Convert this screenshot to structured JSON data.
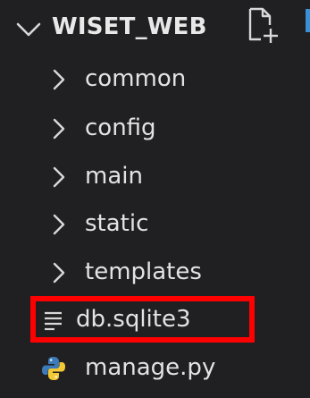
{
  "explorer": {
    "project_title": "WISET_WEB",
    "new_file_icon": "new-file-icon",
    "folders": [
      {
        "label": "common",
        "icon": "chevron-right-icon"
      },
      {
        "label": "config",
        "icon": "chevron-right-icon"
      },
      {
        "label": "main",
        "icon": "chevron-right-icon"
      },
      {
        "label": "static",
        "icon": "chevron-right-icon"
      },
      {
        "label": "templates",
        "icon": "chevron-right-icon"
      }
    ],
    "files": [
      {
        "label": "db.sqlite3",
        "icon": "text-lines-file-icon",
        "highlighted": true
      },
      {
        "label": "manage.py",
        "icon": "python-file-icon"
      }
    ]
  },
  "colors": {
    "background": "#202022",
    "text": "#e3e3e3",
    "highlight_border": "#ff0000",
    "python_blue": "#3d7ab8",
    "python_yellow": "#f2c935"
  }
}
